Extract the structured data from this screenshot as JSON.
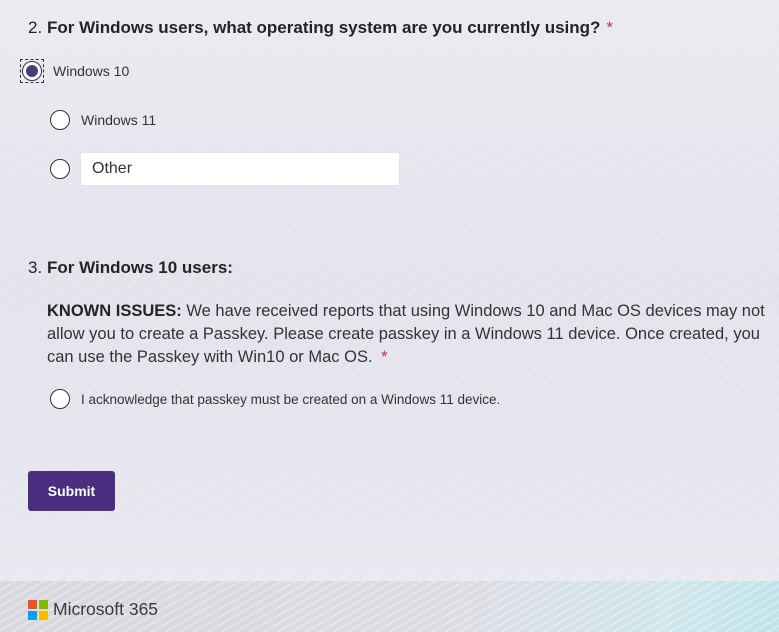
{
  "questions": [
    {
      "number": "2.",
      "title": "For Windows users, what operating system are you currently using?",
      "required_mark": "*",
      "options": [
        {
          "label": "Windows 10",
          "selected": true
        },
        {
          "label": "Windows 11",
          "selected": false
        },
        {
          "label": "Other",
          "selected": false
        }
      ]
    },
    {
      "number": "3.",
      "title": "For Windows 10 users:",
      "description_bold": "KNOWN ISSUES:",
      "description_text": " We have received reports that using Windows 10 and Mac OS devices may not allow you to create a Passkey. Please create passkey in a Windows 11 device. Once created, you can use the Passkey with Win10 or Mac OS.",
      "required_mark": "*",
      "options": [
        {
          "label": "I acknowledge that passkey must be created on a Windows 11 device.",
          "selected": false
        }
      ]
    }
  ],
  "submit_label": "Submit",
  "footer": {
    "brand": "Microsoft 365",
    "logo_colors": [
      "#f25022",
      "#7fba00",
      "#00a4ef",
      "#ffb900"
    ]
  },
  "colors": {
    "accent": "#4b2d7f",
    "required": "#c4314b"
  }
}
